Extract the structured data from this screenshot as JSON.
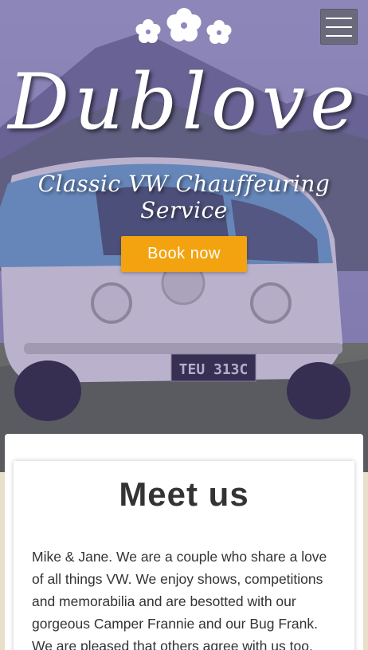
{
  "header": {
    "logo_icon": "hibiscus-flowers-icon",
    "menu_icon": "hamburger-menu-icon"
  },
  "hero": {
    "brand": "Dublove",
    "tagline": "Classic VW Chauffeuring Service",
    "book_label": "Book now",
    "plate_text": "TEU 313C"
  },
  "colors": {
    "accent": "#f2a30f",
    "overlay": "#604ea0",
    "van_blue": "#6aa9c9",
    "text_dark": "#333333"
  },
  "about": {
    "title": "Meet us",
    "paragraph": "Mike & Jane. We are a couple who share a love of all things VW. We enjoy shows, competitions and memorabilia and are besotted with our gorgeous Camper Frannie and our Bug Frank. We are pleased that others agree with us too."
  }
}
